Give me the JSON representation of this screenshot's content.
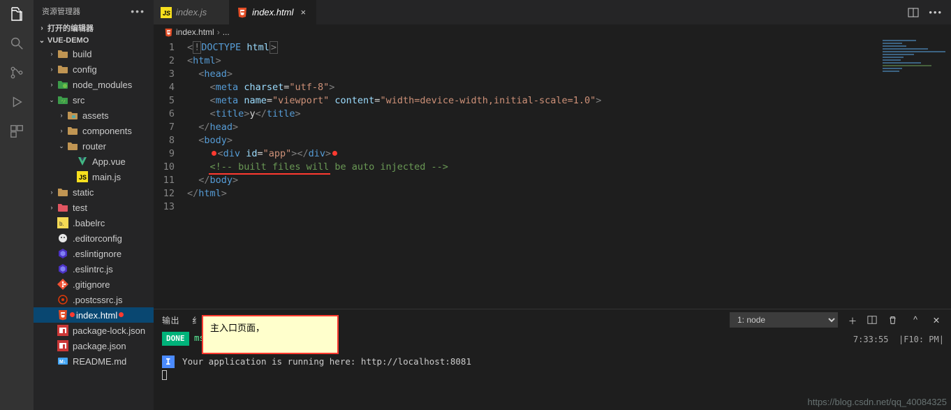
{
  "sidebar": {
    "title": "资源管理器",
    "sections": {
      "openEditors": {
        "label": "打开的编辑器"
      },
      "project": {
        "label": "VUE-DEMO"
      }
    },
    "tree": [
      {
        "depth": 1,
        "kind": "folder",
        "color": "#c09553",
        "label": "build",
        "arrow": ">"
      },
      {
        "depth": 1,
        "kind": "folder",
        "color": "#c09553",
        "label": "config",
        "arrow": ">"
      },
      {
        "depth": 1,
        "kind": "folder",
        "color": "#3c9c4a",
        "label": "node_modules",
        "arrow": ">",
        "icon": "nodefolder"
      },
      {
        "depth": 1,
        "kind": "folder",
        "color": "#3c9c4a",
        "label": "src",
        "arrow": "v",
        "icon": "srcfolder"
      },
      {
        "depth": 2,
        "kind": "folder",
        "color": "#c09553",
        "label": "assets",
        "arrow": ">",
        "icon": "assets"
      },
      {
        "depth": 2,
        "kind": "folder",
        "color": "#c09553",
        "label": "components",
        "arrow": ">"
      },
      {
        "depth": 2,
        "kind": "folder",
        "color": "#c09553",
        "label": "router",
        "arrow": "v"
      },
      {
        "depth": 3,
        "kind": "file",
        "icon": "vue",
        "label": "App.vue"
      },
      {
        "depth": 3,
        "kind": "file",
        "icon": "js",
        "label": "main.js"
      },
      {
        "depth": 1,
        "kind": "folder",
        "color": "#c09553",
        "label": "static",
        "arrow": ">"
      },
      {
        "depth": 1,
        "kind": "folder",
        "color": "#e05561",
        "label": "test",
        "arrow": ">",
        "icon": "testfolder"
      },
      {
        "depth": 1,
        "kind": "file",
        "icon": "babel",
        "label": ".babelrc"
      },
      {
        "depth": 1,
        "kind": "file",
        "icon": "editorcfg",
        "label": ".editorconfig"
      },
      {
        "depth": 1,
        "kind": "file",
        "icon": "eslint",
        "label": ".eslintignore"
      },
      {
        "depth": 1,
        "kind": "file",
        "icon": "eslint",
        "label": ".eslintrc.js"
      },
      {
        "depth": 1,
        "kind": "file",
        "icon": "git",
        "label": ".gitignore"
      },
      {
        "depth": 1,
        "kind": "file",
        "icon": "postcss",
        "label": ".postcssrc.js"
      },
      {
        "depth": 1,
        "kind": "file",
        "icon": "html",
        "label": "index.html",
        "selected": true,
        "dots": true
      },
      {
        "depth": 1,
        "kind": "file",
        "icon": "npm",
        "label": "package-lock.json"
      },
      {
        "depth": 1,
        "kind": "file",
        "icon": "npm",
        "label": "package.json"
      },
      {
        "depth": 1,
        "kind": "file",
        "icon": "md",
        "label": "README.md"
      }
    ]
  },
  "tabs": [
    {
      "icon": "js",
      "label": "index.js",
      "active": false,
      "close": false
    },
    {
      "icon": "html",
      "label": "index.html",
      "active": true,
      "close": true
    }
  ],
  "breadcrumb": {
    "icon": "html",
    "file": "index.html",
    "rest": "..."
  },
  "code": {
    "lines": [
      {
        "n": 1,
        "html": "<span class='p-gray'>&lt;</span><span class='p-gray' style='border:1px solid #555;padding:0 1px'>!</span><span class='p-blue'>DOCTYPE</span> <span class='p-lblue'>html</span><span class='p-gray' style='border:1px solid #555;padding:0 1px'>&gt;</span>"
      },
      {
        "n": 2,
        "html": "<span class='p-gray'>&lt;</span><span class='p-blue'>html</span><span class='p-gray'>&gt;</span>"
      },
      {
        "n": 3,
        "html": "  <span class='p-gray'>&lt;</span><span class='p-blue'>head</span><span class='p-gray'>&gt;</span>"
      },
      {
        "n": 4,
        "html": "    <span class='p-gray'>&lt;</span><span class='p-blue'>meta</span> <span class='p-lblue'>charset</span>=<span class='p-str'>\"utf-8\"</span><span class='p-gray'>&gt;</span>"
      },
      {
        "n": 5,
        "html": "    <span class='p-gray'>&lt;</span><span class='p-blue'>meta</span> <span class='p-lblue'>name</span>=<span class='p-str'>\"viewport\"</span> <span class='p-lblue'>content</span>=<span class='p-str'>\"width=device-width,initial-scale=1.0\"</span><span class='p-gray'>&gt;</span>"
      },
      {
        "n": 6,
        "html": "    <span class='p-gray'>&lt;</span><span class='p-blue'>title</span><span class='p-gray'>&gt;</span>y<span class='p-gray'>&lt;/</span><span class='p-blue'>title</span><span class='p-gray'>&gt;</span>"
      },
      {
        "n": 7,
        "html": "  <span class='p-gray'>&lt;/</span><span class='p-blue'>head</span><span class='p-gray'>&gt;</span>"
      },
      {
        "n": 8,
        "html": "  <span class='p-gray'>&lt;</span><span class='p-blue'>body</span><span class='p-gray'>&gt;</span>"
      },
      {
        "n": 9,
        "html": "    <span class='red-dot'></span><span class='p-gray'>&lt;</span><span class='p-blue'>div</span> <span class='p-lblue'>id</span>=<span class='p-str'>\"app\"</span><span class='p-gray'>&gt;&lt;/</span><span class='p-blue'>div</span><span class='p-gray'>&gt;</span><span class='red-dot'></span>"
      },
      {
        "n": 10,
        "html": "    <span class='p-cmt'><span class='red-underline'>&lt;!-- built files will</span> be auto injected --&gt;</span>"
      },
      {
        "n": 11,
        "html": "  <span class='p-gray'>&lt;/</span><span class='p-blue'>body</span><span class='p-gray'>&gt;</span>"
      },
      {
        "n": 12,
        "html": "<span class='p-gray'>&lt;/</span><span class='p-blue'>html</span><span class='p-gray'>&gt;</span>"
      },
      {
        "n": 13,
        "html": ""
      }
    ]
  },
  "panel": {
    "tabs": [
      "输出",
      "纟"
    ],
    "selector": "1: node",
    "done": "DONE",
    "compiledTail": "ms",
    "runLine1_pre": "I",
    "runLine1": " Your application is running here: http://localhost:8081",
    "footer_time": "7:33:55",
    "footer_key": "F10: PM"
  },
  "tooltip": "主入口页面，",
  "watermark": "https://blog.csdn.net/qq_40084325"
}
